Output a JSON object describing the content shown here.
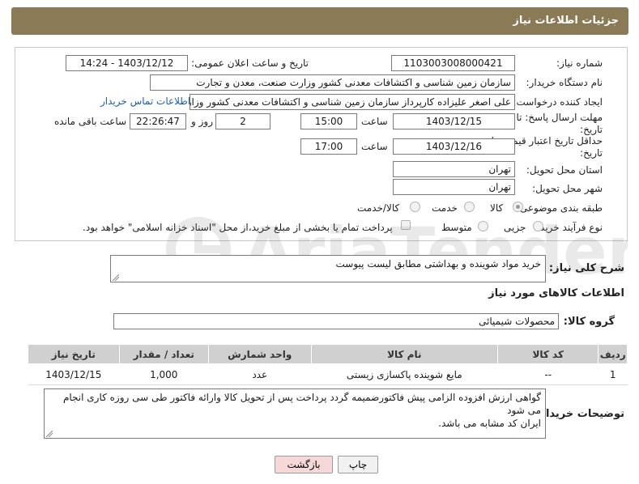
{
  "header": {
    "title": "جزئیات اطلاعات نیاز"
  },
  "form": {
    "need_number": {
      "label": "شماره نیاز:",
      "value": "1103003008000421"
    },
    "announce_datetime": {
      "label": "تاریخ و ساعت اعلان عمومی:",
      "value": "1403/12/12 - 14:24"
    },
    "buyer_org": {
      "label": "نام دستگاه خریدار:",
      "value": "سازمان زمین شناسی و اکتشافات معدنی کشور وزارت صنعت، معدن و تجارت"
    },
    "creator": {
      "label": "ایجاد کننده درخواست:",
      "value": "علی اصغر علیزاده کارپرداز سازمان زمین شناسی و اکتشافات معدنی کشور وزارت",
      "contact_link": "اطلاعات تماس خریدار"
    },
    "reply_deadline": {
      "label_line1": "مهلت ارسال پاسخ: تا",
      "label_line2": "تاریخ:",
      "date": "1403/12/15",
      "time_label": "ساعت",
      "time": "15:00",
      "days": "2",
      "days_label": "روز و",
      "remaining": "22:26:47",
      "remaining_label": "ساعت باقی مانده"
    },
    "price_validity": {
      "label_line1": "حداقل تاریخ اعتبار قیمت: تا",
      "label_line2": "تاریخ:",
      "date": "1403/12/16",
      "time_label": "ساعت",
      "time": "17:00"
    },
    "province": {
      "label": "استان محل تحویل:",
      "value": "تهران"
    },
    "city": {
      "label": "شهر محل تحویل:",
      "value": "تهران"
    },
    "category": {
      "label": "طبقه بندی موضوعی:",
      "options": [
        "کالا",
        "خدمت",
        "کالا/خدمت"
      ],
      "selected": "کالا"
    },
    "purchase_process": {
      "label": "نوع فرآیند خرید :",
      "options": [
        "جزیی",
        "متوسط"
      ],
      "note": "پرداخت تمام یا بخشی از مبلغ خرید،از محل \"اسناد خزانه اسلامی\" خواهد بود."
    }
  },
  "summary": {
    "label": "شرح کلی نیاز:",
    "value": "خرید مواد شوینده و بهداشتی مطابق لیست پیوست"
  },
  "goods_section": {
    "title": "اطلاعات کالاهای مورد نیاز"
  },
  "goods_group": {
    "label": "گروه کالا:",
    "value": "محصولات شیمیائی"
  },
  "table": {
    "headers": [
      "ردیف",
      "کد کالا",
      "نام کالا",
      "واحد شمارش",
      "تعداد / مقدار",
      "تاریخ نیاز"
    ],
    "rows": [
      [
        "1",
        "--",
        "مایع شوینده پاکسازی زیستی",
        "عدد",
        "1,000",
        "1403/12/15"
      ]
    ]
  },
  "buyer_notes": {
    "label": "توضیحات خریدار:",
    "lines": [
      "گواهی ارزش افزوده الزامی پیش فاکتورضمیمه گردد پرداخت پس از تحویل کالا وارائه فاکتور طی سی روزه کاری انجام می شود",
      "ایران کد مشابه می باشد."
    ]
  },
  "actions": {
    "print_label": "چاپ",
    "back_label": "بازگشت"
  },
  "watermark_text": "AriaTender.net",
  "colors": {
    "header_bg": "#8a7a55",
    "table_header_bg": "#d0d0d0",
    "back_button_bg": "#f6d8d8",
    "link": "#1a5fb4"
  }
}
